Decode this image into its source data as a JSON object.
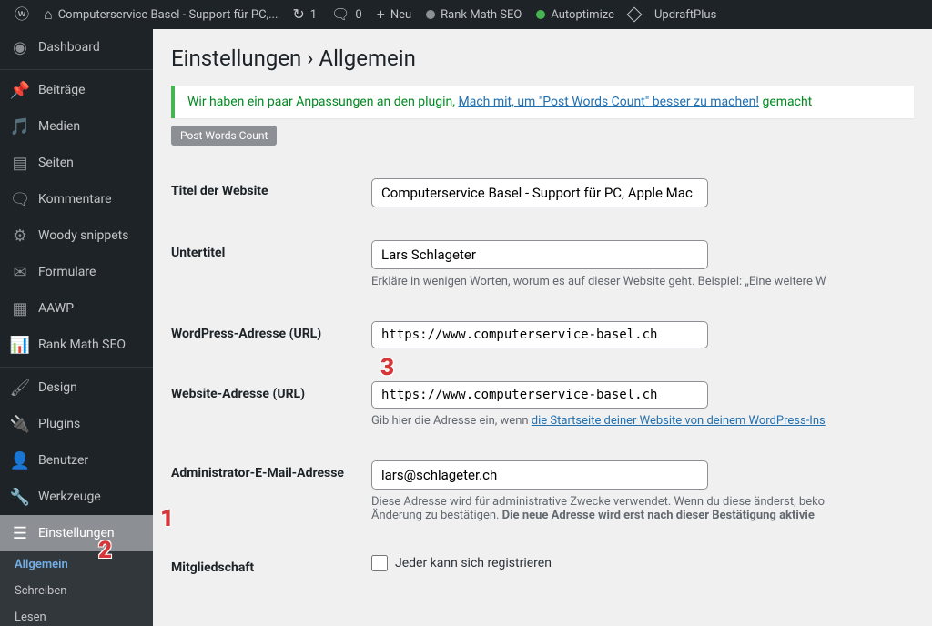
{
  "adminbar": {
    "site_name": "Computerservice Basel - Support für PC,...",
    "refresh_count": "1",
    "comments_count": "0",
    "new_label": "Neu",
    "rankmath_label": "Rank Math SEO",
    "autoptimize_label": "Autoptimize",
    "updraft_label": "UpdraftPlus"
  },
  "sidebar": {
    "items": [
      {
        "label": "Dashboard"
      },
      {
        "label": "Beiträge"
      },
      {
        "label": "Medien"
      },
      {
        "label": "Seiten"
      },
      {
        "label": "Kommentare"
      },
      {
        "label": "Woody snippets"
      },
      {
        "label": "Formulare"
      },
      {
        "label": "AAWP"
      },
      {
        "label": "Rank Math SEO"
      },
      {
        "label": "Design"
      },
      {
        "label": "Plugins"
      },
      {
        "label": "Benutzer"
      },
      {
        "label": "Werkzeuge"
      },
      {
        "label": "Einstellungen"
      }
    ],
    "submenu": [
      {
        "label": "Allgemein"
      },
      {
        "label": "Schreiben"
      },
      {
        "label": "Lesen"
      }
    ]
  },
  "page": {
    "title": "Einstellungen › Allgemein",
    "notice_prefix": "Wir haben ein paar Anpassungen an den plugin, ",
    "notice_link": "Mach mit, um \"Post Words Count\" besser zu machen!",
    "notice_suffix": " gemacht",
    "pill": "Post Words Count"
  },
  "form": {
    "site_title_label": "Titel der Website",
    "site_title_value": "Computerservice Basel - Support für PC, Apple Mac",
    "tagline_label": "Untertitel",
    "tagline_value": "Lars Schlageter",
    "tagline_desc": "Erkläre in wenigen Worten, worum es auf dieser Website geht. Beispiel: „Eine weitere W",
    "wpurl_label": "WordPress-Adresse (URL)",
    "wpurl_value": "https://www.computerservice-basel.ch",
    "siteurl_label": "Website-Adresse (URL)",
    "siteurl_value": "https://www.computerservice-basel.ch",
    "siteurl_desc_a": "Gib hier die Adresse ein, wenn ",
    "siteurl_desc_link": "die Startseite deiner Website von deinem WordPress-Ins",
    "admin_email_label": "Administrator-E-Mail-Adresse",
    "admin_email_value": "lars@schlageter.ch",
    "admin_email_desc_a": "Diese Adresse wird für administrative Zwecke verwendet. Wenn du diese änderst, beko",
    "admin_email_desc_b": "Änderung zu bestätigen. ",
    "admin_email_desc_bold": "Die neue Adresse wird erst nach dieser Bestätigung aktivie",
    "membership_label": "Mitgliedschaft",
    "membership_chk_label": "Jeder kann sich registrieren"
  },
  "annotations": {
    "n1": "1",
    "n2": "2",
    "n3": "3"
  }
}
